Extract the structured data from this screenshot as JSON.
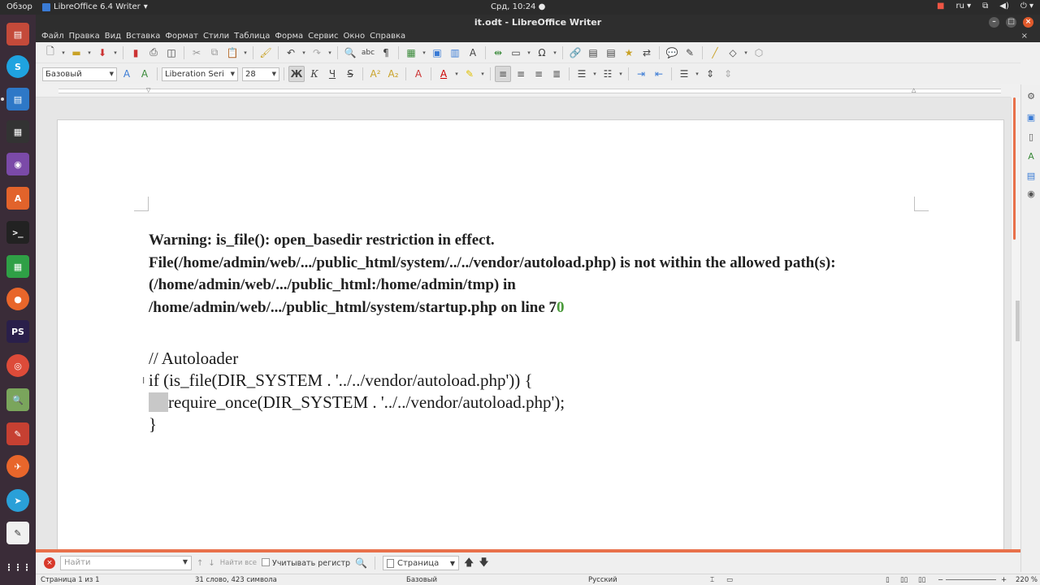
{
  "topbar": {
    "overview": "Обзор",
    "app": "LibreOffice 6.4 Writer",
    "clock": "Срд, 10:24",
    "lang": "ru"
  },
  "window": {
    "title": "it.odt - LibreOffice Writer"
  },
  "menu": [
    "Файл",
    "Правка",
    "Вид",
    "Вставка",
    "Формат",
    "Стили",
    "Таблица",
    "Форма",
    "Сервис",
    "Окно",
    "Справка"
  ],
  "format_toolbar": {
    "style": "Базовый",
    "font": "Liberation Serif",
    "size": "28",
    "bold_glyph": "Ж",
    "italic_glyph": "К",
    "underline_glyph": "Ч",
    "strike_glyph": "S"
  },
  "document": {
    "warning_lines": [
      "Warning: is_file(): open_basedir restriction in effect.",
      "File(/home/admin/web/.../public_html/system/../../vendor/autoload.php) is not within the allowed path(s):",
      "(/home/admin/web/.../public_html:/home/admin/tmp) in",
      "/home/admin/web/.../public_html/system/startup.php on line 7"
    ],
    "line_suffix_green": "0",
    "code_lines": [
      "// Autoloader",
      "if (is_file(DIR_SYSTEM . '../../vendor/autoload.php')) {",
      "require_once(DIR_SYSTEM . '../../vendor/autoload.php');",
      "}"
    ]
  },
  "findbar": {
    "placeholder": "Найти",
    "find_all": "Найти все",
    "match_case": "Учитывать регистр",
    "nav_target": "Страница"
  },
  "statusbar": {
    "page": "Страница 1 из 1",
    "words": "31 слово, 423 символа",
    "style": "Базовый",
    "language": "Русский",
    "zoom": "220 %"
  },
  "colors": {
    "accent": "#e8714b",
    "launcher_bg": "#3a2c38",
    "topbar_bg": "#2b2b2b",
    "warning_green": "#4a9a3a"
  }
}
